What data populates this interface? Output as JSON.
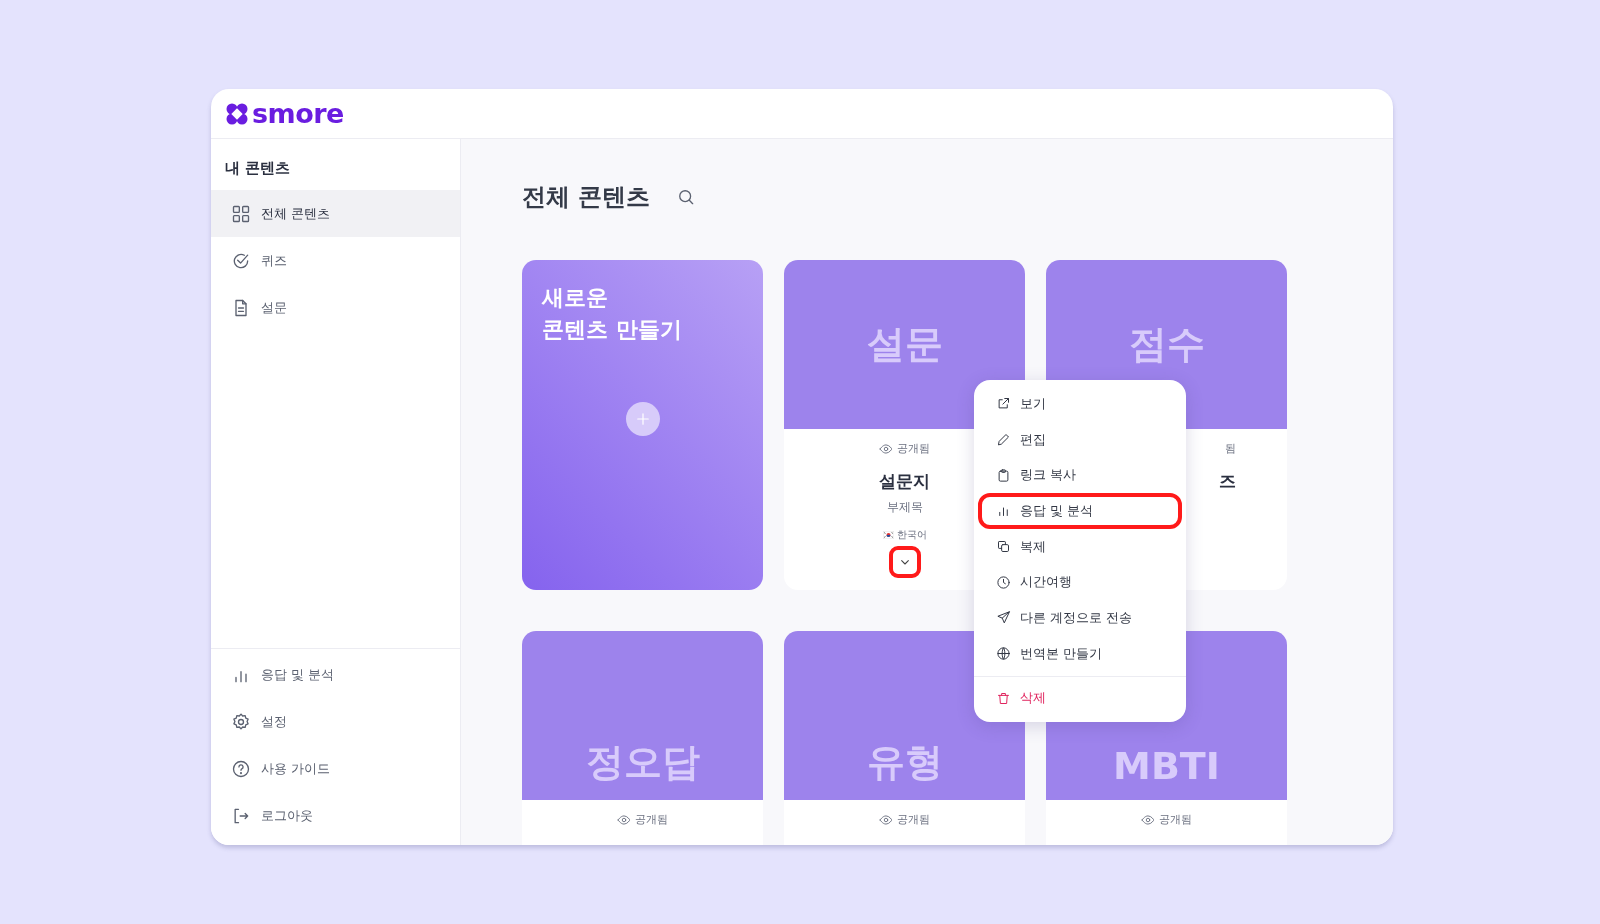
{
  "logo": {
    "text": "smore"
  },
  "sidebar": {
    "heading": "내 콘텐츠",
    "items": [
      {
        "label": "전체 콘텐츠",
        "selected": true
      },
      {
        "label": "퀴즈",
        "selected": false
      },
      {
        "label": "설문",
        "selected": false
      }
    ],
    "bottom_items": [
      {
        "label": "응답 및 분석"
      },
      {
        "label": "설정"
      },
      {
        "label": "사용 가이드"
      },
      {
        "label": "로그아웃"
      }
    ]
  },
  "page": {
    "title": "전체 콘텐츠"
  },
  "create_card": {
    "title": "새로운\n콘텐츠 만들기"
  },
  "cards": [
    {
      "cover": "설문",
      "status": "공개됨",
      "title": "설문지",
      "subtitle": "부제목",
      "language": "한국어",
      "dropdown_highlighted": true
    },
    {
      "cover": "점수",
      "status": "됨",
      "title": "즈"
    },
    {
      "cover": "정오답",
      "status": "공개됨"
    },
    {
      "cover": "유형",
      "status": "공개됨"
    },
    {
      "cover": "MBTI",
      "status": "공개됨"
    }
  ],
  "menu": [
    {
      "label": "보기",
      "kind": "normal",
      "highlighted": false
    },
    {
      "label": "편집",
      "kind": "normal",
      "highlighted": false
    },
    {
      "label": "링크 복사",
      "kind": "normal",
      "highlighted": false
    },
    {
      "label": "응답 및 분석",
      "kind": "normal",
      "highlighted": true
    },
    {
      "label": "복제",
      "kind": "normal",
      "highlighted": false
    },
    {
      "label": "시간여행",
      "kind": "normal",
      "highlighted": false
    },
    {
      "label": "다른 계정으로 전송",
      "kind": "normal",
      "highlighted": false
    },
    {
      "label": "번역본 만들기",
      "kind": "normal",
      "highlighted": false
    },
    {
      "label": "삭제",
      "kind": "danger",
      "highlighted": false
    }
  ]
}
